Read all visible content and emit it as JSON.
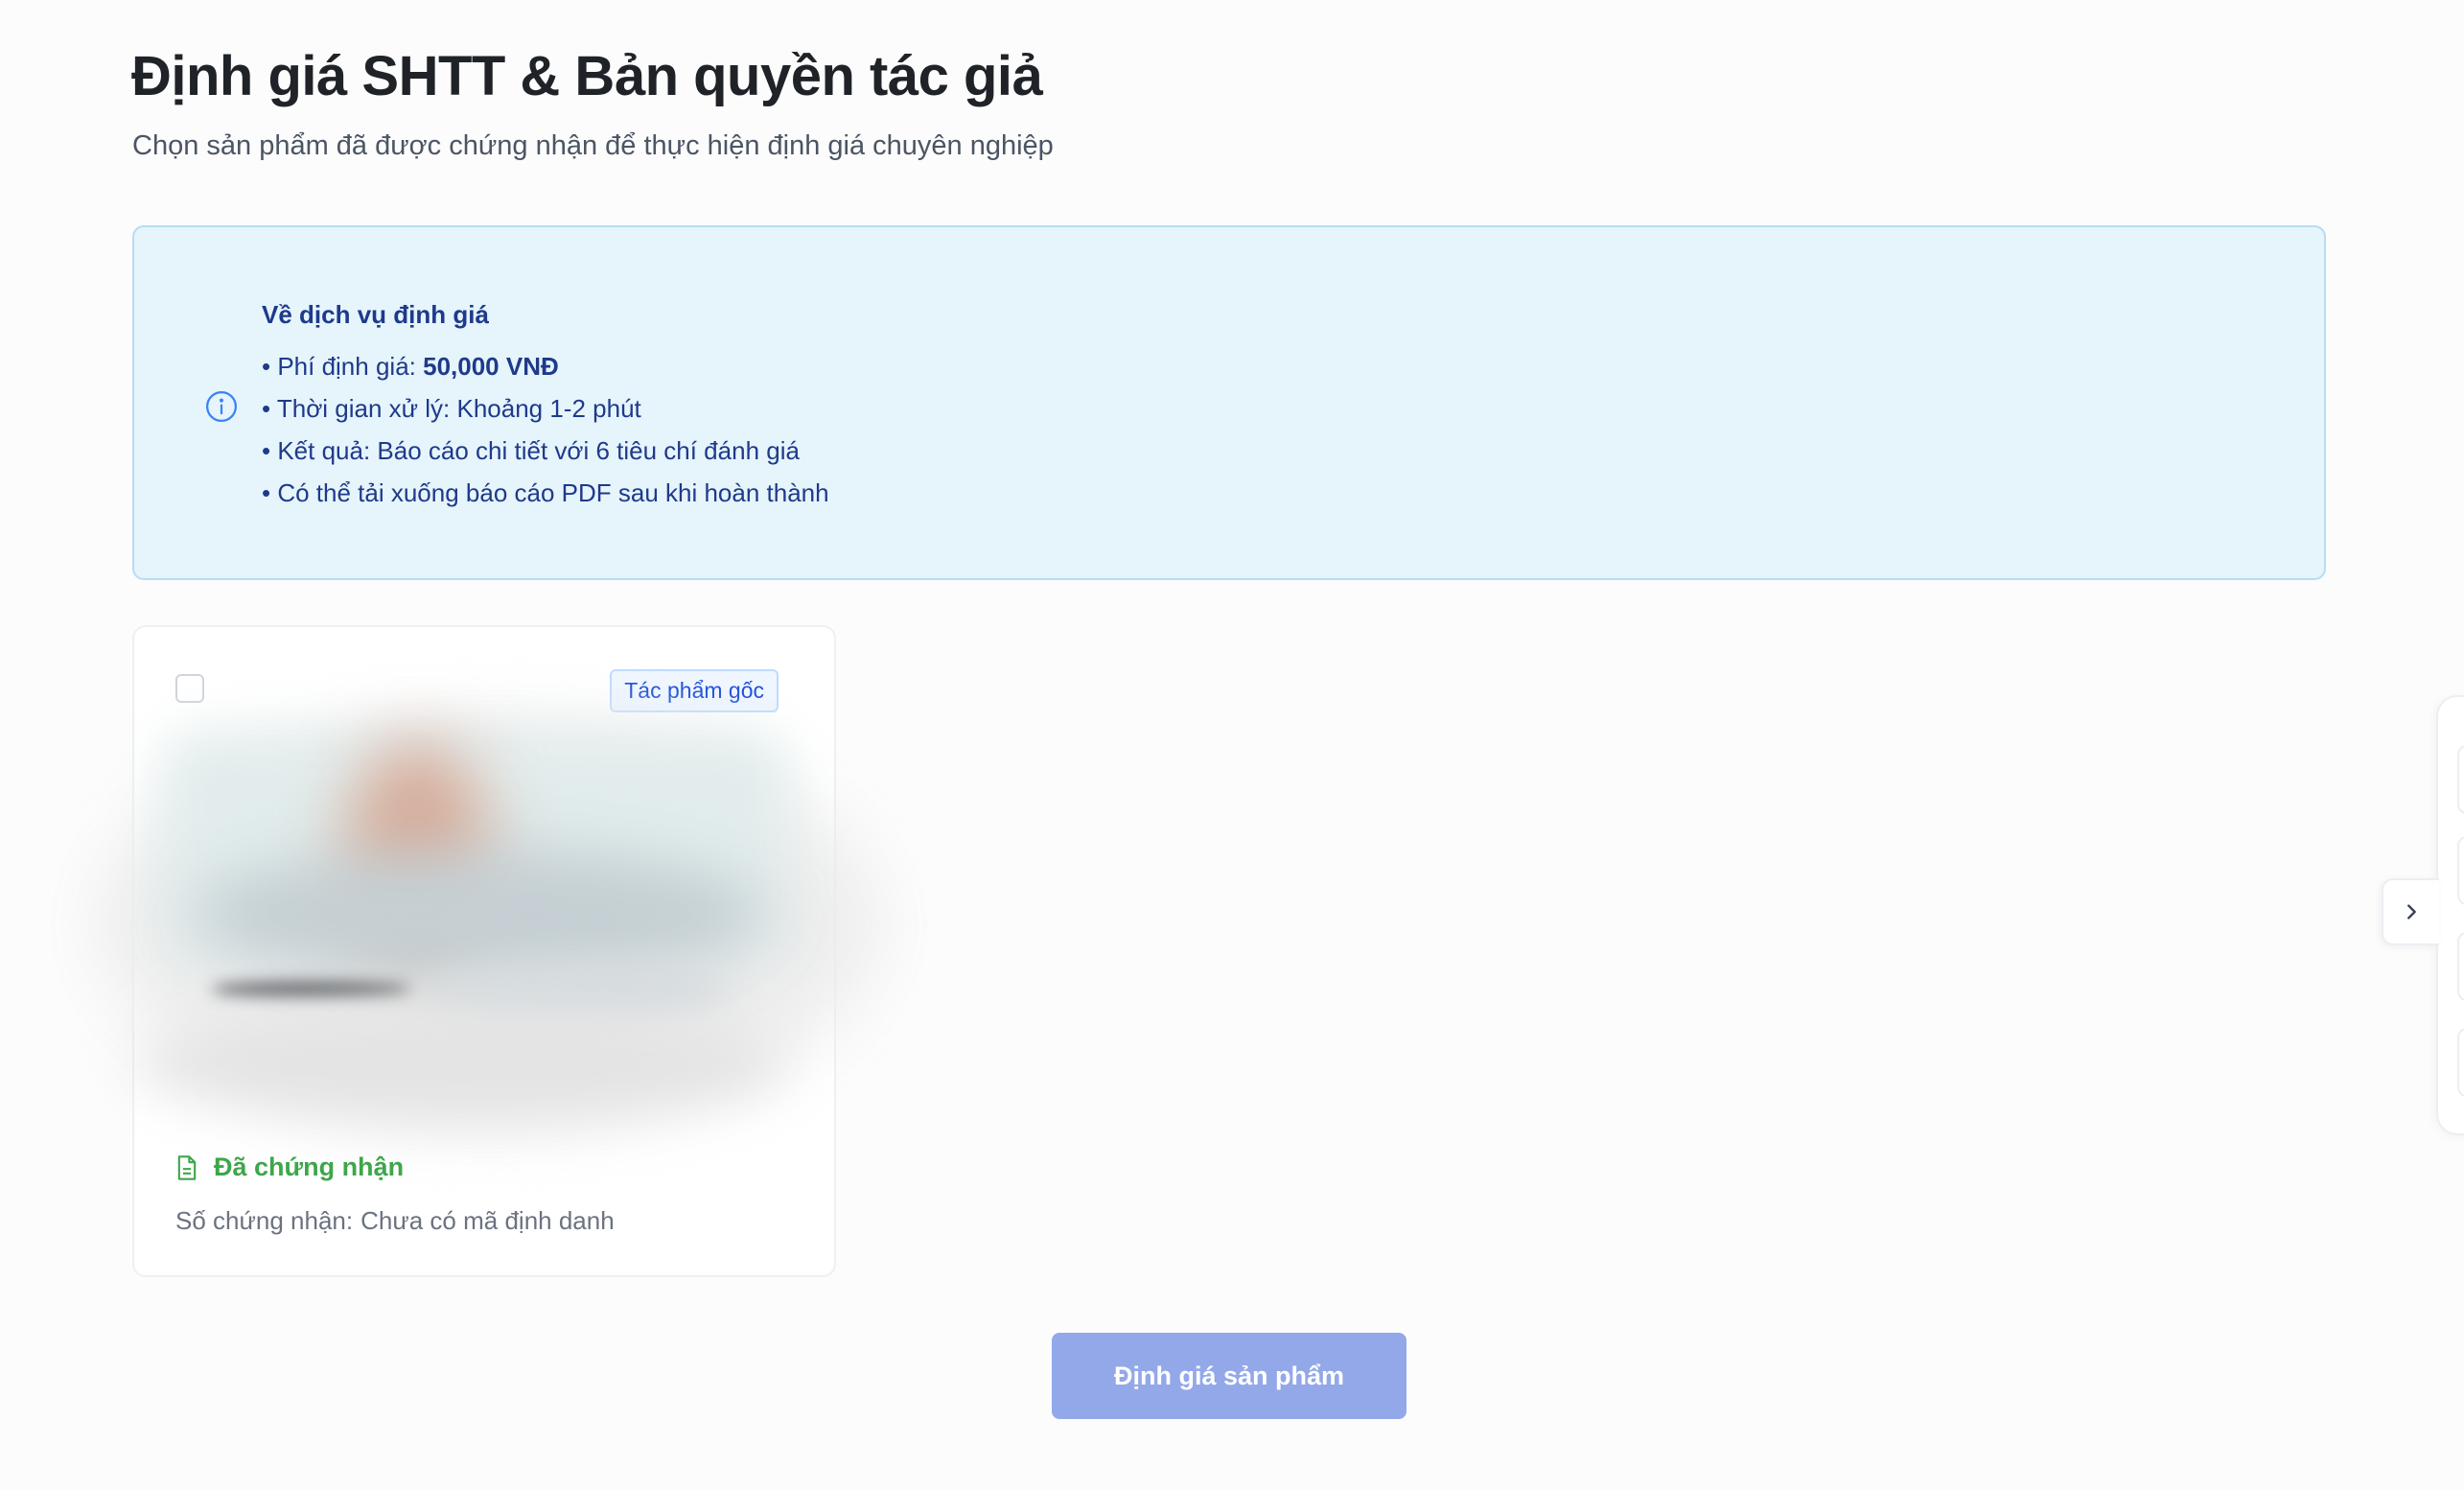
{
  "header": {
    "title": "Định giá SHTT & Bản quyền tác giả",
    "subtitle": "Chọn sản phẩm đã được chứng nhận để thực hiện định giá chuyên nghiệp"
  },
  "info_box": {
    "icon": "info-circle-icon",
    "title": "Về dịch vụ định giá",
    "fee_label": "• Phí định giá:",
    "fee_value": "50,000 VNĐ",
    "items": [
      "• Thời gian xử lý: Khoảng 1-2 phút",
      "• Kết quả: Báo cáo chi tiết với 6 tiêu chí đánh giá",
      "• Có thể tải xuống báo cáo PDF sau khi hoàn thành"
    ],
    "colors": {
      "background": "#e6f4fc",
      "border": "#b7dcf3",
      "text": "#1e3a8a",
      "icon": "#3b82f6"
    }
  },
  "products": [
    {
      "badge": "Tác phẩm gốc",
      "selected": false,
      "status_icon": "document-icon",
      "status": "Đã chứng nhận",
      "cert_label": "Số chứng nhận:",
      "cert_value": "Chưa có mã định danh",
      "status_color": "#3ea64a"
    }
  ],
  "actions": {
    "submit_label": "Định giá sản phẩm",
    "submit_color": "#93a8e8"
  },
  "side_panel": {
    "toggle_icon": "chevron-right-icon"
  }
}
